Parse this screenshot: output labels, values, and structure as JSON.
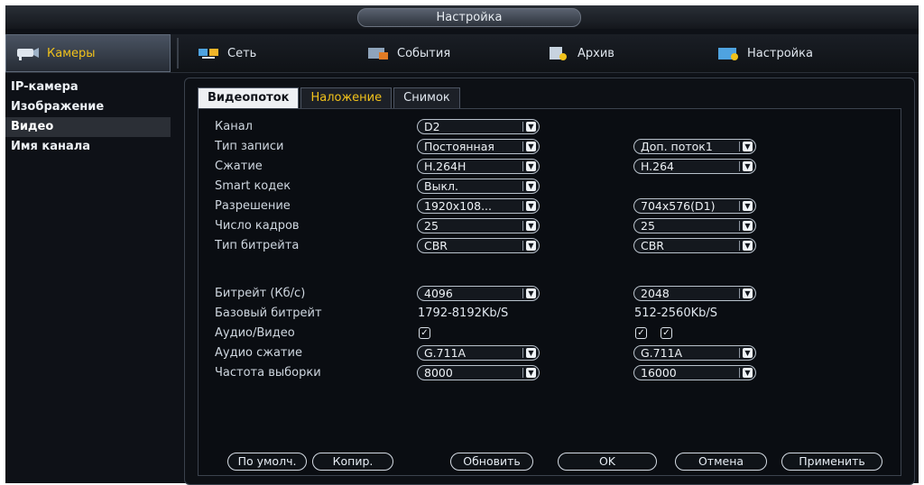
{
  "window": {
    "title": "Настройка"
  },
  "topnav": {
    "items": [
      {
        "label": "Камеры",
        "icon": "camera-icon"
      },
      {
        "label": "Сеть",
        "icon": "network-icon"
      },
      {
        "label": "События",
        "icon": "events-icon"
      },
      {
        "label": "Архив",
        "icon": "archive-icon"
      },
      {
        "label": "Настройка",
        "icon": "settings-icon"
      }
    ]
  },
  "sidebar": {
    "items": [
      {
        "label": "IP-камера"
      },
      {
        "label": "Изображение"
      },
      {
        "label": "Видео"
      },
      {
        "label": "Имя канала"
      }
    ]
  },
  "tabs": [
    {
      "label": "Видеопоток"
    },
    {
      "label": "Наложение"
    },
    {
      "label": "Снимок"
    }
  ],
  "form": {
    "channel": {
      "label": "Канал",
      "value": "D2"
    },
    "record_type": {
      "label": "Тип записи",
      "main": "Постоянная",
      "extra": "Доп. поток1"
    },
    "compression": {
      "label": "Сжатие",
      "main": "H.264H",
      "extra": "H.264"
    },
    "smart_codec": {
      "label": "Smart кодек",
      "main": "Выкл."
    },
    "resolution": {
      "label": "Разрешение",
      "main": "1920x108...",
      "extra": "704x576(D1)"
    },
    "frame_rate": {
      "label": "Число кадров",
      "main": "25",
      "extra": "25"
    },
    "bitrate_type": {
      "label": "Тип битрейта",
      "main": "CBR",
      "extra": "CBR"
    },
    "bitrate": {
      "label": "Битрейт (Кб/с)",
      "main": "4096",
      "extra": "2048"
    },
    "base_bitrate": {
      "label": "Базовый битрейт",
      "main": "1792-8192Kb/S",
      "extra": "512-2560Kb/S"
    },
    "audio_video": {
      "label": "Аудио/Видео"
    },
    "audio_compression": {
      "label": "Аудио сжатие",
      "main": "G.711A",
      "extra": "G.711A"
    },
    "sample_rate": {
      "label": "Частота выборки",
      "main": "8000",
      "extra": "16000"
    }
  },
  "buttons": {
    "default": "По умолч.",
    "copy": "Копир.",
    "refresh": "Обновить",
    "ok": "OK",
    "cancel": "Отмена",
    "apply": "Применить"
  },
  "colors": {
    "accent": "#f1c21b",
    "background": "#0e1117",
    "text": "#e6ecf3"
  }
}
